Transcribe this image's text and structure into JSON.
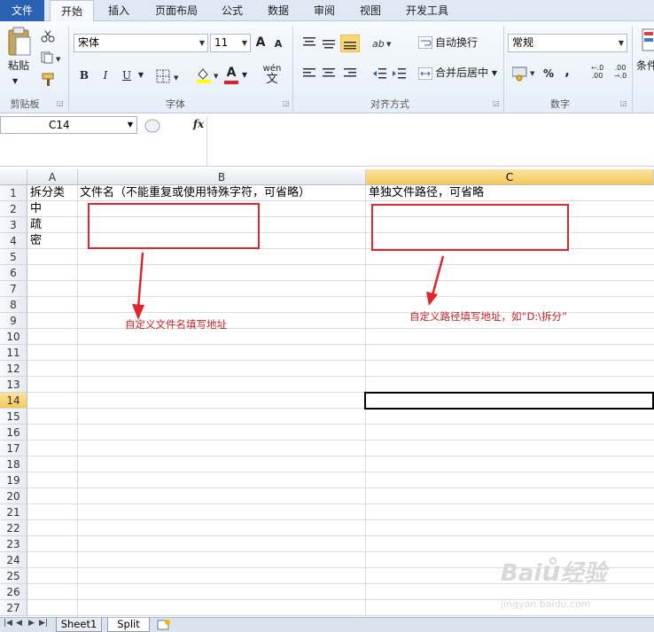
{
  "ribbon_tabs": [
    "文件",
    "开始",
    "插入",
    "页面布局",
    "公式",
    "数据",
    "审阅",
    "视图",
    "开发工具"
  ],
  "active_tab": "开始",
  "clipboard": {
    "paste_label": "粘贴",
    "group_label": "剪贴板"
  },
  "font": {
    "name": "宋体",
    "size": "11",
    "group_label": "字体",
    "bold": "B",
    "italic": "I",
    "underline": "U",
    "grow": "A",
    "shrink": "A",
    "font_color": "A",
    "wen": "wén"
  },
  "alignment": {
    "wrap_label": "自动换行",
    "merge_label": "合并后居中",
    "group_label": "对齐方式"
  },
  "number": {
    "format": "常规",
    "group_label": "数字",
    "percent": "%",
    "comma": ","
  },
  "styles": {
    "conditional_label": "条件"
  },
  "formula_bar": {
    "name_box": "C14",
    "fx": "fx",
    "value": ""
  },
  "columns": [
    {
      "label": "A",
      "selected": false
    },
    {
      "label": "B",
      "selected": false
    },
    {
      "label": "C",
      "selected": true
    }
  ],
  "row_numbers": [
    "1",
    "2",
    "3",
    "4",
    "5",
    "6",
    "7",
    "8",
    "9",
    "10",
    "11",
    "12",
    "13",
    "14",
    "15",
    "16",
    "17",
    "18",
    "19",
    "20",
    "21",
    "22",
    "23",
    "24",
    "25",
    "26",
    "27"
  ],
  "selected_row": "14",
  "cells": {
    "A1": "拆分类",
    "B1": "文件名（不能重复或使用特殊字符，可省略）",
    "C1": "单独文件路径，可省略",
    "A2": "中",
    "A3": "疏",
    "A4": "密"
  },
  "annotations": {
    "file_name_note": "自定义文件名填写地址",
    "path_note": "自定义路径填写地址，如“D:\\拆分”"
  },
  "annotation_color": "#e0262b",
  "sheets": [
    {
      "name": "Sheet1",
      "active": false
    },
    {
      "name": "Split",
      "active": true
    }
  ],
  "watermark": "Baidu经验 jingyan.baidu.com"
}
